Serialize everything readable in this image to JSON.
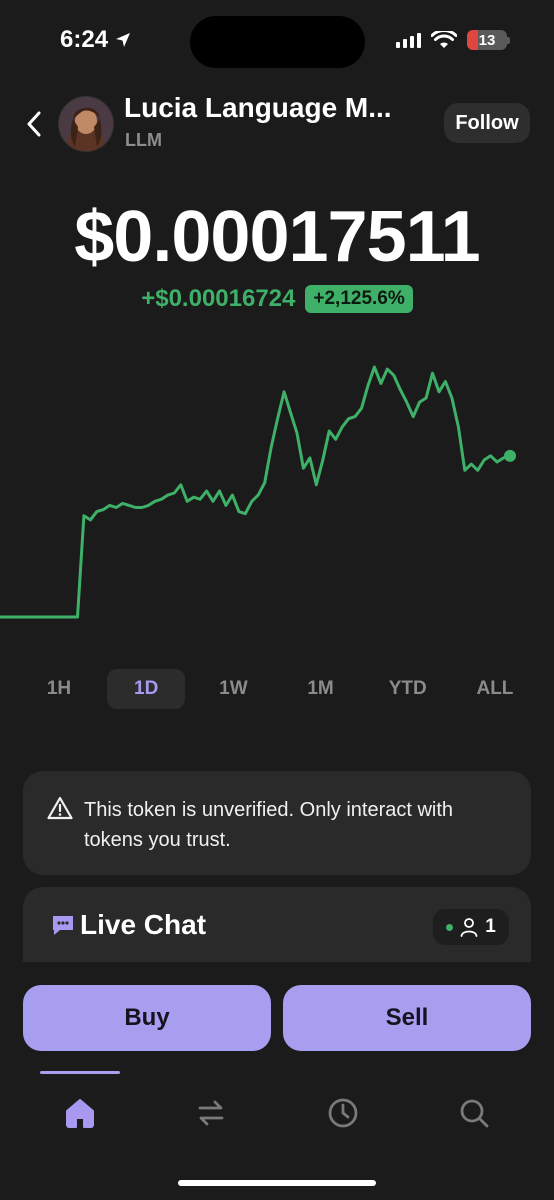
{
  "status_bar": {
    "time": "6:24",
    "battery": "13"
  },
  "header": {
    "back_icon": "chevron-left-icon",
    "token_name": "Lucia Language M...",
    "token_symbol": "LLM",
    "follow_label": "Follow"
  },
  "price": {
    "current": "$0.00017511",
    "change_abs": "+$0.00016724",
    "change_pct": "+2,125.6%"
  },
  "colors": {
    "positive": "#3fb068",
    "accent": "#a89ef0",
    "background": "#1b1b1b"
  },
  "chart_data": {
    "type": "line",
    "series": [
      {
        "values": [
          1,
          1,
          1,
          1,
          1,
          1,
          1,
          1,
          1,
          1,
          1,
          1,
          1,
          5.9,
          5.7,
          6.1,
          6.2,
          6.4,
          6.3,
          6.5,
          6.4,
          6.3,
          6.3,
          6.4,
          6.6,
          6.7,
          6.9,
          7.0,
          7.4,
          6.6,
          6.8,
          6.7,
          7.1,
          6.6,
          7.1,
          6.4,
          6.9,
          6.1,
          6.0,
          6.6,
          6.9,
          7.5,
          9.2,
          10.6,
          11.9,
          10.9,
          9.9,
          8.2,
          8.7,
          7.4,
          8.6,
          10.0,
          9.6,
          10.2,
          10.6,
          10.7,
          11.1,
          12.2,
          13.1,
          12.3,
          13.0,
          12.7,
          12.0,
          11.4,
          10.7,
          11.4,
          11.6,
          12.8,
          11.9,
          12.4,
          11.6,
          10.2,
          8.1,
          8.4,
          8.1,
          8.6,
          8.8,
          8.5,
          8.7,
          8.8
        ]
      }
    ],
    "ranges": [
      "1H",
      "1D",
      "1W",
      "1M",
      "YTD",
      "ALL"
    ],
    "selected_range": "1D"
  },
  "warning": {
    "icon": "warning-triangle-icon",
    "text": "This token is unverified. Only interact with tokens you trust."
  },
  "live_chat": {
    "title": "Live Chat",
    "viewer_count": "1"
  },
  "actions": {
    "buy": "Buy",
    "sell": "Sell"
  },
  "tab_bar": {
    "tabs": [
      "home-icon",
      "swap-icon",
      "history-icon",
      "search-icon"
    ],
    "active": "home-icon"
  }
}
